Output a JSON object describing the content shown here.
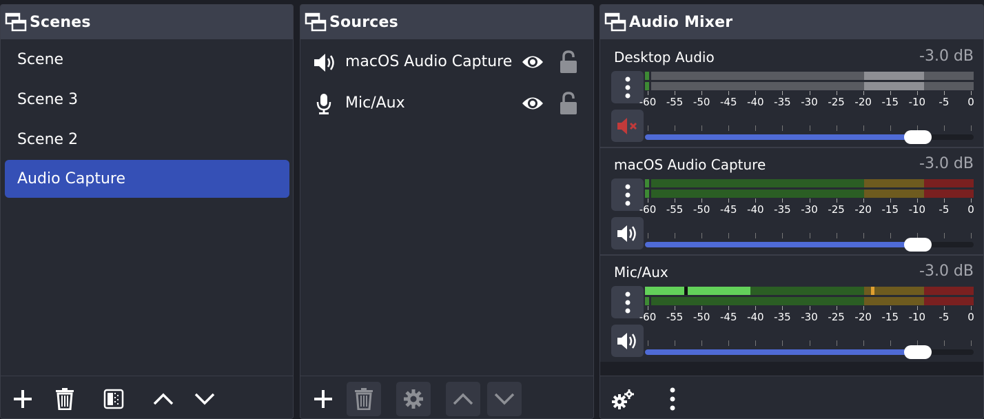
{
  "scenes": {
    "title": "Scenes",
    "items": [
      {
        "label": "Scene",
        "selected": false
      },
      {
        "label": "Scene 3",
        "selected": false
      },
      {
        "label": "Scene 2",
        "selected": false
      },
      {
        "label": "Audio Capture",
        "selected": true
      }
    ],
    "footer": [
      "add-icon",
      "trash-icon",
      "filter-icon",
      "chevron-up-icon",
      "chevron-down-icon"
    ]
  },
  "sources": {
    "title": "Sources",
    "items": [
      {
        "label": "macOS Audio Capture",
        "icon": "speaker-icon",
        "visible": true,
        "locked": false
      },
      {
        "label": "Mic/Aux",
        "icon": "microphone-icon",
        "visible": true,
        "locked": false
      }
    ],
    "footer": [
      "add-icon",
      "trash-icon",
      "gear-icon",
      "chevron-up-icon",
      "chevron-down-icon"
    ]
  },
  "mixer": {
    "title": "Audio Mixer",
    "scale_labels": [
      "-60",
      "-55",
      "-50",
      "-45",
      "-40",
      "-35",
      "-30",
      "-25",
      "-20",
      "-15",
      "-10",
      "-5",
      "0"
    ],
    "channels": [
      {
        "name": "Desktop Audio",
        "db": "-3.0 dB",
        "muted": true,
        "volume_fraction": 0.83,
        "meter_style": "inactive",
        "level_fraction": 0.0
      },
      {
        "name": "macOS Audio Capture",
        "db": "-3.0 dB",
        "muted": false,
        "volume_fraction": 0.83,
        "meter_style": "active",
        "level_fraction": 0.0
      },
      {
        "name": "Mic/Aux",
        "db": "-3.0 dB",
        "muted": false,
        "volume_fraction": 0.83,
        "meter_style": "active",
        "level_fraction": 0.32
      }
    ],
    "footer": [
      "advanced-audio-gear-icon",
      "more-options-icon"
    ]
  },
  "colors": {
    "accent": "#3550b6",
    "slider": "#4f6bd6",
    "meter_green": "#2b5e24",
    "meter_green_bright": "#63d15a",
    "meter_yellow": "#6e5b1f",
    "meter_red": "#7a2020",
    "mute_red": "#c23a3a"
  }
}
